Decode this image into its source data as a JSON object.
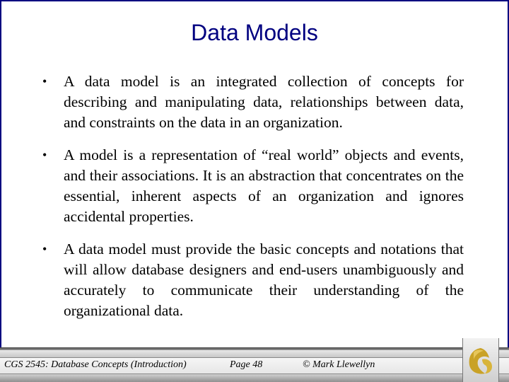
{
  "slide": {
    "title": "Data Models",
    "bullets": [
      {
        "text": "A data model is an integrated collection of concepts for describing and manipulating data, relationships between data, and constraints on the data in an organization."
      },
      {
        "text": "A model is a representation of “real world” objects and events, and their associations.  It is an abstraction that concentrates on the essential, inherent aspects of an organization and ignores accidental properties."
      },
      {
        "text": "A data model must provide the basic concepts and notations that will allow database designers and end-users unambiguously and accurately to communicate their understanding of the organizational data."
      }
    ],
    "bullet_glyph": "•"
  },
  "footer": {
    "course": "CGS 2545: Database Concepts  (Introduction)",
    "page": "Page 48",
    "copyright": "© Mark Llewellyn",
    "logo_icon": "pegasus-logo-icon"
  },
  "colors": {
    "title": "#000080",
    "border": "#000080",
    "logo": "#c9a227"
  }
}
